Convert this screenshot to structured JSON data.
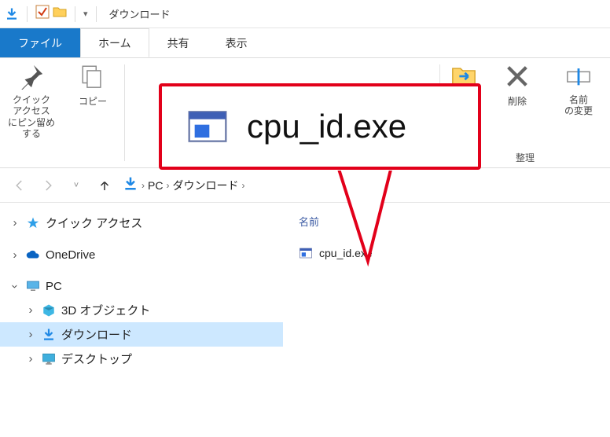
{
  "titlebar": {
    "title": "ダウンロード"
  },
  "tabs": {
    "file": "ファイル",
    "home": "ホーム",
    "share": "共有",
    "view": "表示"
  },
  "ribbon": {
    "pin": "クイック アクセス\nにピン留めする",
    "copy": "コピー",
    "move_to": "移動先",
    "delete": "削除",
    "rename": "名前\nの変更",
    "group_organize": "整理"
  },
  "breadcrumb": {
    "pc": "PC",
    "downloads": "ダウンロード"
  },
  "tree": {
    "quick_access": "クイック アクセス",
    "onedrive": "OneDrive",
    "pc": "PC",
    "objects3d": "3D オブジェクト",
    "downloads": "ダウンロード",
    "desktop": "デスクトップ"
  },
  "content": {
    "col_name": "名前",
    "file1": "cpu_id.exe"
  },
  "callout": {
    "text": "cpu_id.exe"
  }
}
